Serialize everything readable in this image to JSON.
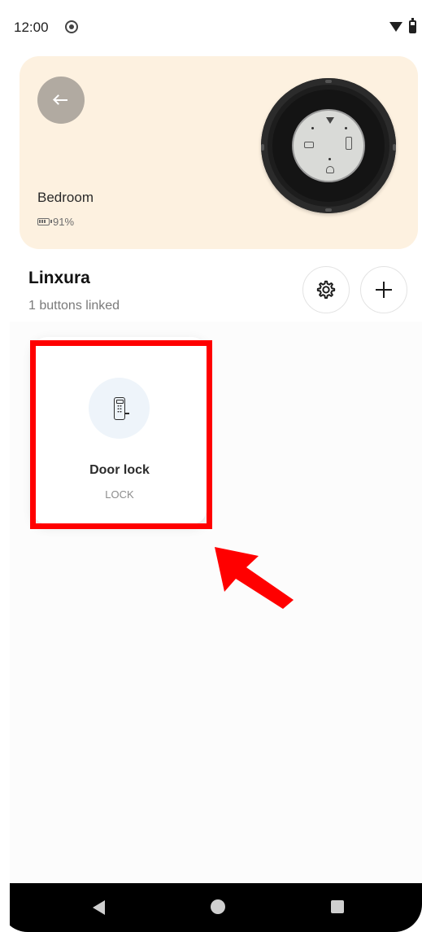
{
  "status_bar": {
    "time": "12:00"
  },
  "device": {
    "room_name": "Bedroom",
    "battery": "91%"
  },
  "section": {
    "title": "Linxura",
    "subtitle": "1 buttons linked"
  },
  "buttons": [
    {
      "name": "Door lock",
      "type": "LOCK",
      "icon": "door-lock-icon"
    }
  ],
  "icons": {
    "back": "arrow-left-icon",
    "settings": "gear-icon",
    "add": "plus-icon"
  },
  "colors": {
    "hero_background": "#fdf1e0",
    "back_button": "#b1aaa1",
    "card_icon_background": "#eef4fa",
    "annotation": "#ff0000"
  }
}
